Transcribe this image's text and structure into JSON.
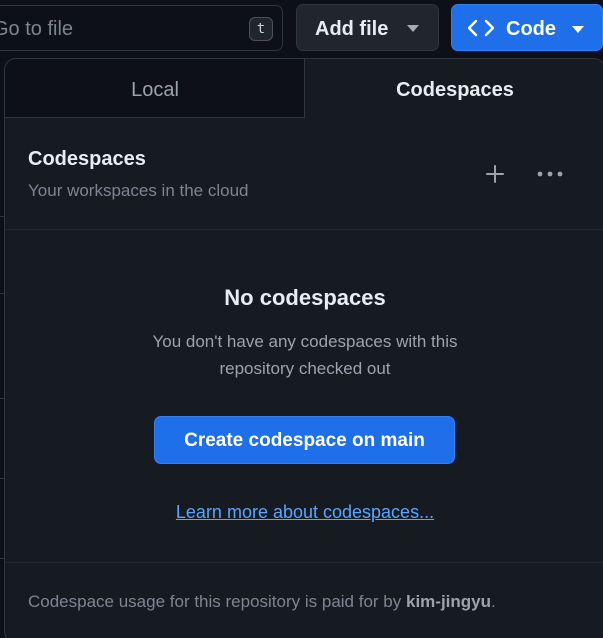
{
  "toolbar": {
    "goto_placeholder": "Go to file",
    "goto_shortcut": "t",
    "add_file_label": "Add file",
    "code_label": "Code"
  },
  "tabs": [
    {
      "label": "Local",
      "selected": false
    },
    {
      "label": "Codespaces",
      "selected": true
    }
  ],
  "codespaces": {
    "title": "Codespaces",
    "subtitle": "Your workspaces in the cloud",
    "empty_title": "No codespaces",
    "empty_description": "You don't have any codespaces with this repository checked out",
    "create_button_label": "Create codespace on main",
    "learn_more_link": "Learn more about codespaces...",
    "footer_prefix": "Codespace usage for this repository is paid for by ",
    "footer_owner": "kim-jingyu",
    "footer_suffix": "."
  },
  "colors": {
    "background": "#0d1117",
    "panel": "#161b22",
    "accent": "#1f6feb",
    "link": "#58a6ff",
    "border": "#30363d"
  },
  "icons": [
    "code-brackets-icon",
    "chevron-down-icon",
    "plus-icon",
    "kebab-horizontal-icon"
  ]
}
